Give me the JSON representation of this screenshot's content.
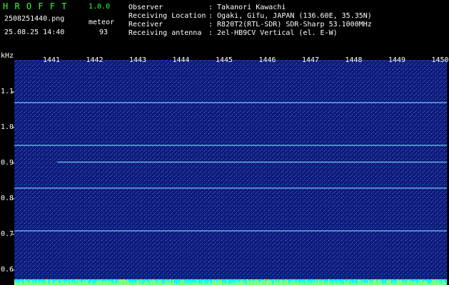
{
  "header": {
    "app_name": "H R O F F T",
    "version": "1.0.0",
    "filename": "2508251440.png",
    "mode": "meteor",
    "datetime": "25.08.25 14:40",
    "count": "93",
    "info_labels": [
      "Observer",
      "Receiving Location",
      "Receiver",
      "Receiving antenna"
    ],
    "info_values": [
      ": Takanori Kawachi",
      ": Ogaki, Gifu, JAPAN (136.60E, 35.35N)",
      ": R820T2(RTL-SDR) SDR-Sharp 53.1000MHz",
      ": 2el-HB9CV Vertical (el. E-W)"
    ]
  },
  "chart_data": {
    "type": "heatmap",
    "ylabel": "kHz",
    "y_ticks": [
      "1.1",
      "1.0",
      "0.9",
      "0.8",
      "0.7",
      "0.6"
    ],
    "x_ticks": [
      "1441",
      "1442",
      "1443",
      "1444",
      "1445",
      "1446",
      "1447",
      "1448",
      "1449",
      "1450"
    ],
    "horizontal_lines_khz": [
      1.07,
      0.95,
      0.903,
      0.83,
      0.71
    ],
    "background_color": "#10208a",
    "trace_color": "#7fe0ff"
  }
}
